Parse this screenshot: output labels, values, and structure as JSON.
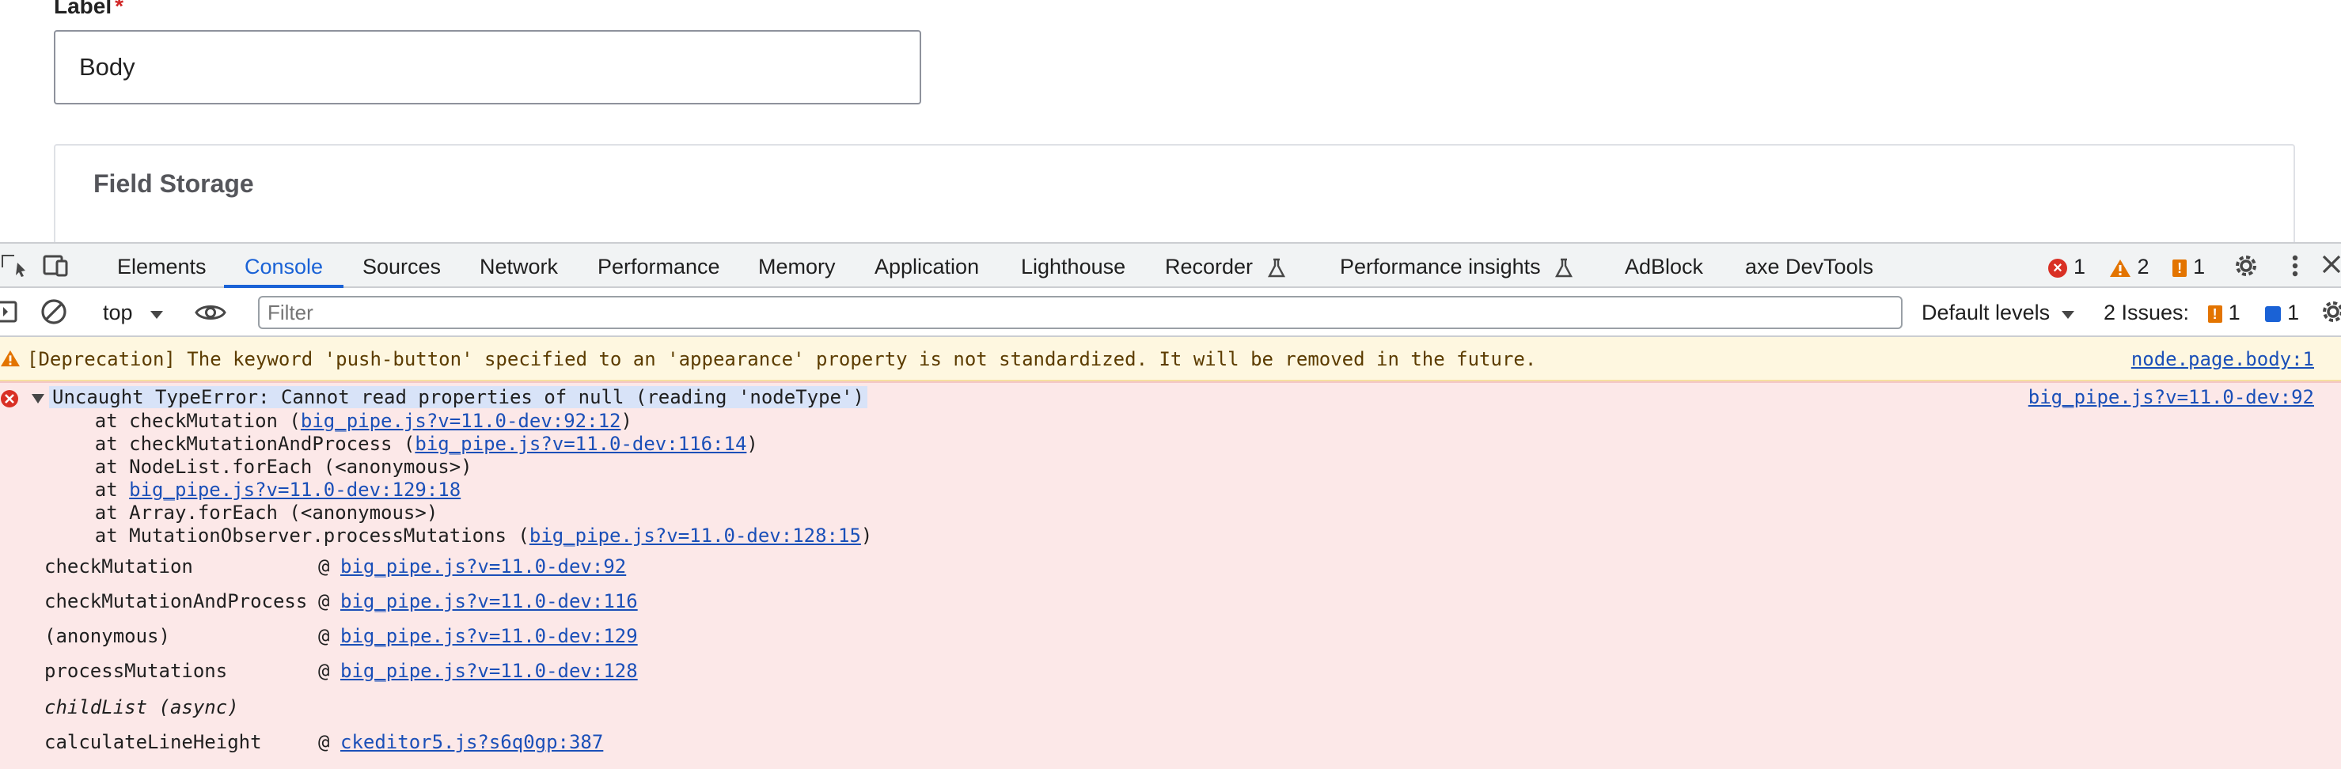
{
  "form": {
    "label": "Label",
    "required_mark": "*",
    "input_value": "Body",
    "card_title": "Field Storage"
  },
  "devtools": {
    "tabs": [
      "Elements",
      "Console",
      "Sources",
      "Network",
      "Performance",
      "Memory",
      "Application",
      "Lighthouse",
      "Recorder",
      "Performance insights",
      "AdBlock",
      "axe DevTools"
    ],
    "active_tab": "Console",
    "counts": {
      "errors": "1",
      "warnings": "2",
      "info": "1"
    },
    "icons": [
      "inspect-icon",
      "device-toolbar-icon",
      "flask-icon",
      "settings-icon",
      "more-icon",
      "close-icon"
    ]
  },
  "console_toolbar": {
    "context": "top",
    "filter_placeholder": "Filter",
    "levels": "Default levels",
    "issues_label": "2 Issues:",
    "issues_warn": "1",
    "issues_info": "1"
  },
  "messages": {
    "warning": {
      "text": "[Deprecation] The keyword 'push-button' specified to an 'appearance' property is not standardized. It will be removed in the future.",
      "source": "node.page.body:1"
    },
    "error": {
      "head": "Uncaught TypeError: Cannot read properties of null (reading 'nodeType')",
      "source": "big_pipe.js?v=11.0-dev:92",
      "stack": [
        {
          "pre": "    at checkMutation (",
          "link": "big_pipe.js?v=11.0-dev:92:12",
          "post": ")"
        },
        {
          "pre": "    at checkMutationAndProcess (",
          "link": "big_pipe.js?v=11.0-dev:116:14",
          "post": ")"
        },
        {
          "pre": "    at NodeList.forEach (<anonymous>)",
          "link": "",
          "post": ""
        },
        {
          "pre": "    at ",
          "link": "big_pipe.js?v=11.0-dev:129:18",
          "post": ""
        },
        {
          "pre": "    at Array.forEach (<anonymous>)",
          "link": "",
          "post": ""
        },
        {
          "pre": "    at MutationObserver.processMutations (",
          "link": "big_pipe.js?v=11.0-dev:128:15",
          "post": ")"
        }
      ],
      "frames": [
        {
          "fn": "checkMutation",
          "at": "@",
          "file": "big_pipe.js?v=11.0-dev:92"
        },
        {
          "fn": "checkMutationAndProcess",
          "at": "@",
          "file": "big_pipe.js?v=11.0-dev:116"
        },
        {
          "fn": "(anonymous)",
          "at": "@",
          "file": "big_pipe.js?v=11.0-dev:129"
        },
        {
          "fn": "processMutations",
          "at": "@",
          "file": "big_pipe.js?v=11.0-dev:128"
        },
        {
          "fn": "childList (async)",
          "at": "",
          "file": ""
        },
        {
          "fn": "calculateLineHeight",
          "at": "@",
          "file": "ckeditor5.js?s6q0gp:387"
        }
      ]
    }
  }
}
